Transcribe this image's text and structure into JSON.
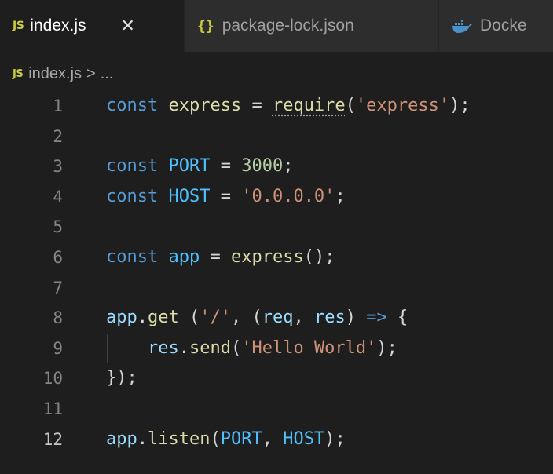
{
  "tabs": [
    {
      "icon": "JS",
      "label": "index.js",
      "close": "✕"
    },
    {
      "icon": "{}",
      "label": "package-lock.json"
    },
    {
      "label": "Docke"
    }
  ],
  "breadcrumb": {
    "icon": "JS",
    "file": "index.js",
    "separator": ">",
    "ellipsis": "..."
  },
  "editor": {
    "active_line": 12,
    "lines": [
      {
        "n": "1",
        "tokens": [
          [
            "kw",
            "const"
          ],
          [
            "pun",
            " "
          ],
          [
            "fn",
            "express"
          ],
          [
            "pun",
            " = "
          ],
          [
            "fn",
            "require",
            "hint"
          ],
          [
            "pun",
            "("
          ],
          [
            "str",
            "'express'"
          ],
          [
            "pun",
            ");"
          ]
        ]
      },
      {
        "n": "2",
        "tokens": []
      },
      {
        "n": "3",
        "tokens": [
          [
            "kw",
            "const"
          ],
          [
            "pun",
            " "
          ],
          [
            "const",
            "PORT"
          ],
          [
            "pun",
            " = "
          ],
          [
            "num",
            "3000"
          ],
          [
            "pun",
            ";"
          ]
        ]
      },
      {
        "n": "4",
        "tokens": [
          [
            "kw",
            "const"
          ],
          [
            "pun",
            " "
          ],
          [
            "const",
            "HOST"
          ],
          [
            "pun",
            " = "
          ],
          [
            "str",
            "'0.0.0.0'"
          ],
          [
            "pun",
            ";"
          ]
        ]
      },
      {
        "n": "5",
        "tokens": []
      },
      {
        "n": "6",
        "tokens": [
          [
            "kw",
            "const"
          ],
          [
            "pun",
            " "
          ],
          [
            "const",
            "app"
          ],
          [
            "pun",
            " = "
          ],
          [
            "fn",
            "express"
          ],
          [
            "pun",
            "();"
          ]
        ]
      },
      {
        "n": "7",
        "tokens": []
      },
      {
        "n": "8",
        "tokens": [
          [
            "var",
            "app"
          ],
          [
            "pun",
            "."
          ],
          [
            "fn",
            "get"
          ],
          [
            "pun",
            " ("
          ],
          [
            "str",
            "'/'"
          ],
          [
            "pun",
            ", ("
          ],
          [
            "var",
            "req"
          ],
          [
            "pun",
            ", "
          ],
          [
            "var",
            "res"
          ],
          [
            "pun",
            ") "
          ],
          [
            "kw",
            "=>"
          ],
          [
            "pun",
            " {"
          ]
        ]
      },
      {
        "n": "9",
        "tokens": [
          [
            "pun",
            "    "
          ],
          [
            "var",
            "res"
          ],
          [
            "pun",
            "."
          ],
          [
            "fn",
            "send"
          ],
          [
            "pun",
            "("
          ],
          [
            "str",
            "'Hello World'"
          ],
          [
            "pun",
            ");"
          ]
        ]
      },
      {
        "n": "10",
        "tokens": [
          [
            "pun",
            "});"
          ]
        ]
      },
      {
        "n": "11",
        "tokens": []
      },
      {
        "n": "12",
        "tokens": [
          [
            "var",
            "app"
          ],
          [
            "pun",
            "."
          ],
          [
            "fn",
            "listen"
          ],
          [
            "pun",
            "("
          ],
          [
            "const",
            "PORT"
          ],
          [
            "pun",
            ", "
          ],
          [
            "const",
            "HOST"
          ],
          [
            "pun",
            ");"
          ]
        ]
      }
    ]
  },
  "colors": {
    "background": "#1e1e1e",
    "keyword": "#569cd6",
    "constant": "#4fc1ff",
    "variable": "#9cdcfe",
    "function": "#dcdcaa",
    "string": "#ce9178",
    "number": "#b5cea8",
    "line_number": "#858585"
  }
}
